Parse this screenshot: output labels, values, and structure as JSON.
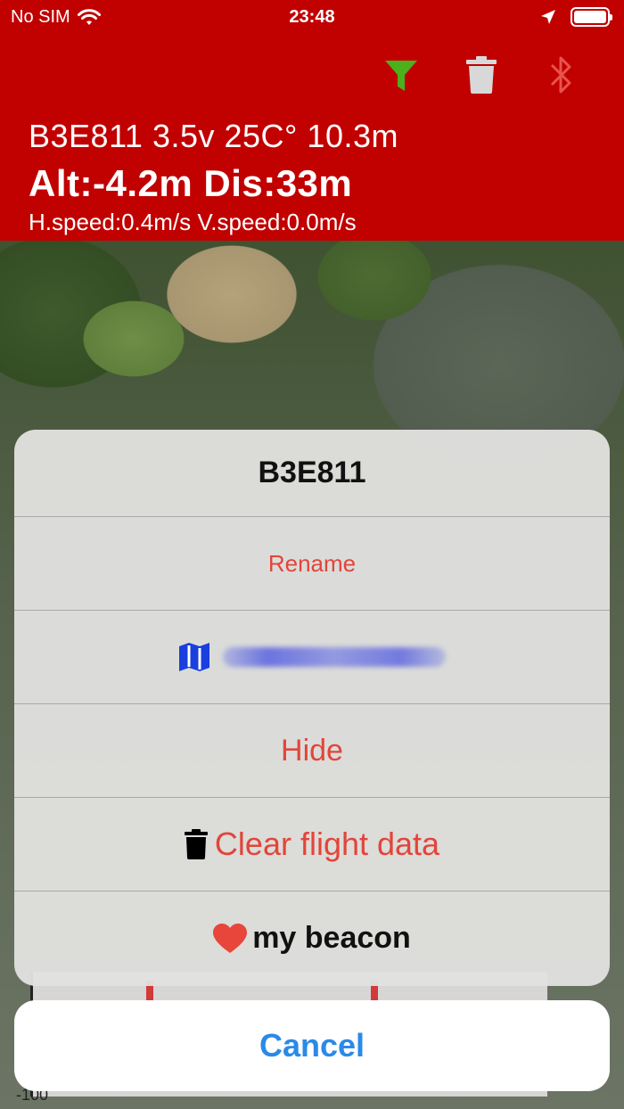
{
  "status_bar": {
    "carrier": "No SIM",
    "time": "23:48"
  },
  "header": {
    "line1": "B3E811  3.5v 25C° 10.3m",
    "line2": "Alt:-4.2m  Dis:33m",
    "line3": "H.speed:0.4m/s  V.speed:0.0m/s",
    "icons": [
      "filter-icon",
      "trash-icon",
      "bluetooth-icon"
    ]
  },
  "map": {
    "bottom_label": "-100"
  },
  "action_sheet": {
    "title": "B3E811",
    "rename_label": "Rename",
    "hide_label": "Hide",
    "clear_label": "Clear flight data",
    "beacon_label": "my beacon"
  },
  "cancel_label": "Cancel",
  "colors": {
    "header_red": "#c10000",
    "destructive_red": "#e2453a",
    "cancel_blue": "#2a8ae8",
    "filter_green": "#4caf1c",
    "map_icon_blue": "#1a3fe0"
  }
}
